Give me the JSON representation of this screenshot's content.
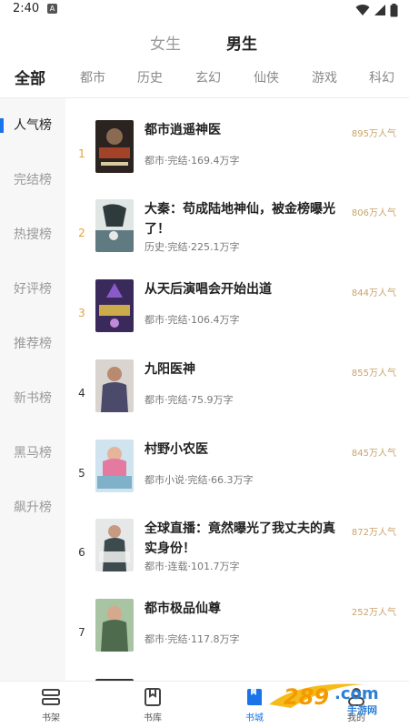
{
  "status_bar": {
    "time": "2:40",
    "notif_icon": "A"
  },
  "gender_tabs": [
    {
      "label": "女生",
      "active": false
    },
    {
      "label": "男生",
      "active": true
    }
  ],
  "categories": [
    {
      "label": "全部",
      "active": true
    },
    {
      "label": "都市"
    },
    {
      "label": "历史"
    },
    {
      "label": "玄幻"
    },
    {
      "label": "仙侠"
    },
    {
      "label": "游戏"
    },
    {
      "label": "科幻"
    }
  ],
  "side_nav": [
    {
      "label": "人气榜",
      "active": true
    },
    {
      "label": "完结榜"
    },
    {
      "label": "热搜榜"
    },
    {
      "label": "好评榜"
    },
    {
      "label": "推荐榜"
    },
    {
      "label": "新书榜"
    },
    {
      "label": "黑马榜"
    },
    {
      "label": "飙升榜"
    }
  ],
  "books": [
    {
      "rank": "1",
      "title": "都市逍遥神医",
      "meta": "都市·完结·169.4万字",
      "popularity": "895万人气",
      "cover_text": "都市逍遥神医",
      "cover_color": "#2a2320"
    },
    {
      "rank": "2",
      "title": "大秦：苟成陆地神仙，被金榜曝光了！",
      "meta": "历史·完结·225.1万字",
      "popularity": "806万人气",
      "cover_text": "陆地神仙",
      "cover_color": "#5f7a80"
    },
    {
      "rank": "3",
      "title": "从天后演唱会开始出道",
      "meta": "都市·完结·106.4万字",
      "popularity": "844万人气",
      "cover_text": "开始出道",
      "cover_color": "#3a2a5c"
    },
    {
      "rank": "4",
      "title": "九阳医神",
      "meta": "都市·完结·75.9万字",
      "popularity": "855万人气",
      "cover_text": "",
      "cover_color": "#4b4a6a"
    },
    {
      "rank": "5",
      "title": "村野小农医",
      "meta": "都市小说·完结·66.3万字",
      "popularity": "845万人气",
      "cover_text": "村野小农医",
      "cover_color": "#7fb1c9"
    },
    {
      "rank": "6",
      "title": "全球直播：竟然曝光了我丈夫的真实身份！",
      "meta": "都市·连载·101.7万字",
      "popularity": "872万人气",
      "cover_text": "丈夫的真实身份",
      "cover_color": "#3d4a4e"
    },
    {
      "rank": "7",
      "title": "都市极品仙尊",
      "meta": "都市·完结·117.8万字",
      "popularity": "252万人气",
      "cover_text": "",
      "cover_color": "#4f6b4d"
    }
  ],
  "bottom_nav": [
    {
      "label": "书架",
      "icon": "bookshelf-icon"
    },
    {
      "label": "书库",
      "icon": "bookmark-book-icon"
    },
    {
      "label": "书城",
      "icon": "bookstore-icon",
      "active": true
    },
    {
      "label": "我的",
      "icon": "profile-icon"
    }
  ],
  "watermark": {
    "brand": "289.com",
    "sub": "手游网"
  },
  "colors": {
    "accent": "#1a73e8",
    "rank_top": "#e4a23a",
    "popularity": "#c9a36a"
  }
}
